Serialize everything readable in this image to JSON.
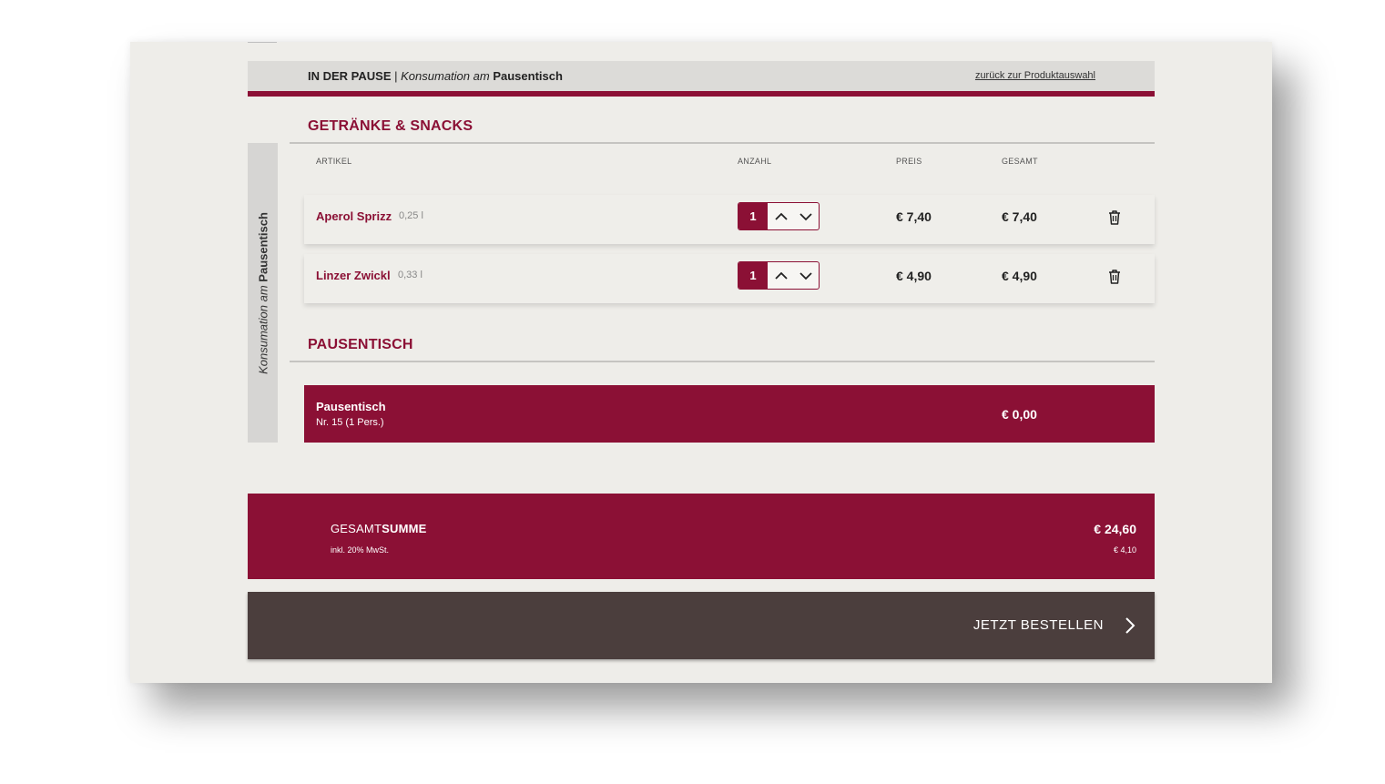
{
  "header": {
    "breadcrumb_bold": "IN DER PAUSE",
    "breadcrumb_sep": "|",
    "breadcrumb_italic": "Konsumation am",
    "breadcrumb_end": "Pausentisch",
    "back_link": "zurück zur Produktauswahl"
  },
  "sidebar": {
    "label_italic": "Konsumation am",
    "label_bold": "Pausentisch"
  },
  "drinks": {
    "title": "GETRÄNKE & SNACKS",
    "columns": {
      "article": "ARTIKEL",
      "quantity": "ANZAHL",
      "price": "PREIS",
      "total": "GESAMT"
    },
    "items": [
      {
        "name": "Aperol Sprizz",
        "size": "0,25 l",
        "qty": "1",
        "price": "€ 7,40",
        "total": "€ 7,40"
      },
      {
        "name": "Linzer Zwickl",
        "size": "0,33 l",
        "qty": "1",
        "price": "€ 4,90",
        "total": "€ 4,90"
      }
    ]
  },
  "table": {
    "title": "PAUSENTISCH",
    "name": "Pausentisch",
    "detail": "Nr. 15 (1 Pers.)",
    "amount": "€ 0,00"
  },
  "summary": {
    "label_light": "GESAMT",
    "label_bold": "SUMME",
    "vat_note": "inkl. 20% MwSt.",
    "total": "€ 24,60",
    "vat_amount": "€ 4,10"
  },
  "order_button": {
    "label": "JETZT BESTELLEN"
  },
  "icons": {
    "up": "chevron-up-icon",
    "down": "chevron-down-icon",
    "delete": "trash-icon",
    "next": "chevron-right-icon"
  },
  "colors": {
    "accent": "#8b1035",
    "button_dark": "#4b3e3d",
    "card_bg": "#eeede9",
    "header_bg": "#dcdbd8"
  }
}
